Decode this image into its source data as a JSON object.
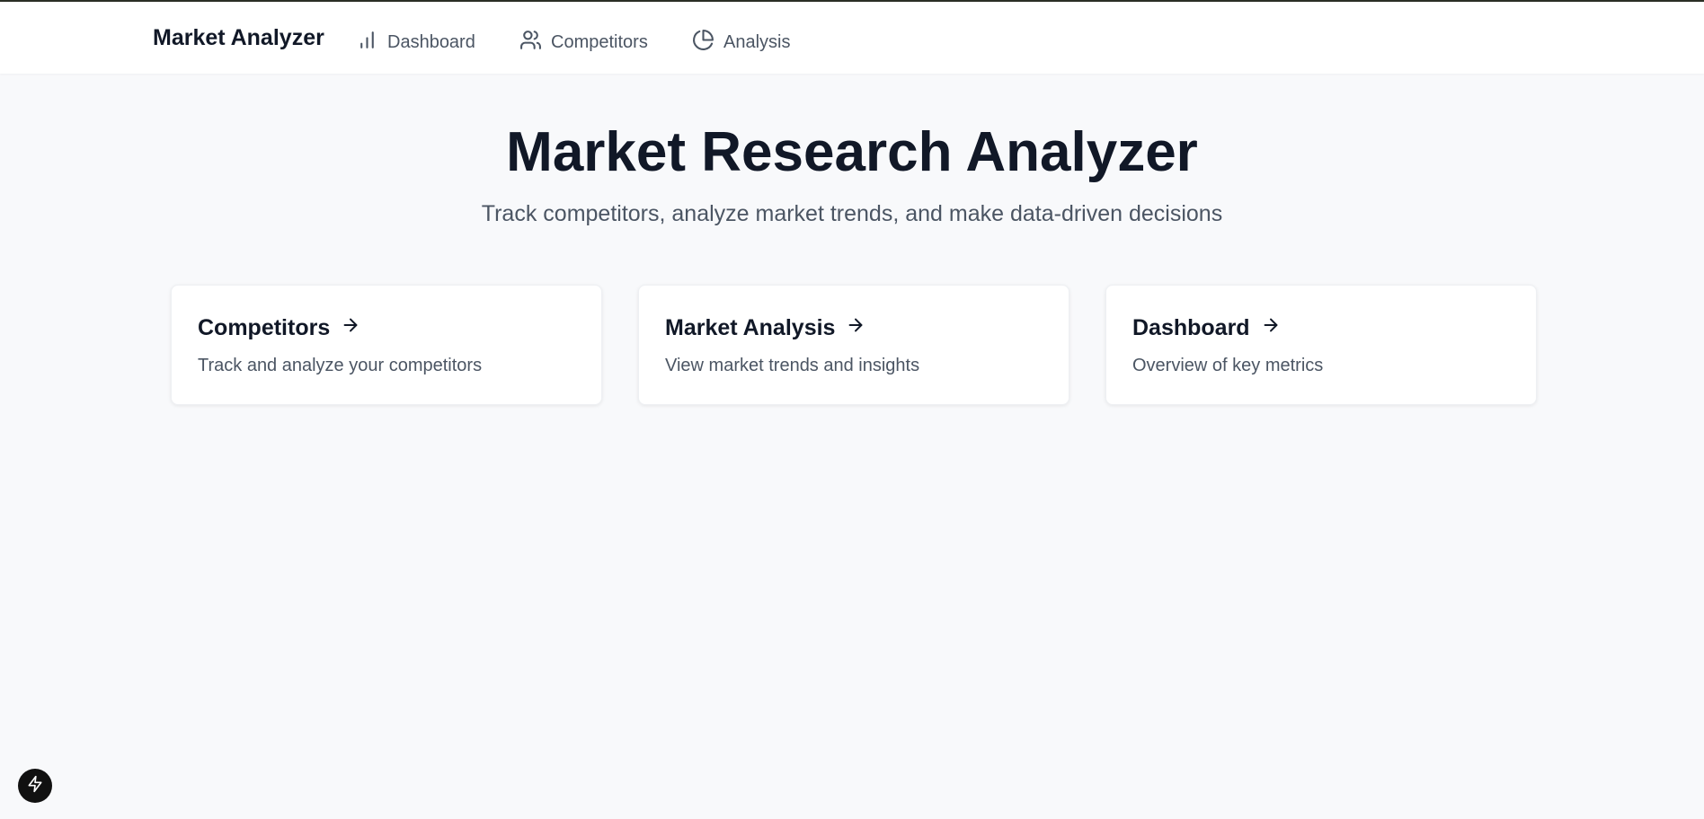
{
  "nav": {
    "brand": "Market Analyzer",
    "links": [
      {
        "label": "Dashboard",
        "icon": "bar-chart-icon"
      },
      {
        "label": "Competitors",
        "icon": "users-icon"
      },
      {
        "label": "Analysis",
        "icon": "pie-chart-icon"
      }
    ]
  },
  "hero": {
    "title": "Market Research Analyzer",
    "subtitle": "Track competitors, analyze market trends, and make data-driven decisions"
  },
  "cards": [
    {
      "title": "Competitors",
      "description": "Track and analyze your competitors",
      "icon": "arrow-right-icon"
    },
    {
      "title": "Market Analysis",
      "description": "View market trends and insights",
      "icon": "arrow-right-icon"
    },
    {
      "title": "Dashboard",
      "description": "Overview of key metrics",
      "icon": "arrow-right-icon"
    }
  ],
  "fab": {
    "icon": "lightning-icon"
  },
  "colors": {
    "background": "#f8f9fb",
    "surface": "#ffffff",
    "text_primary": "#111827",
    "text_secondary": "#4b5563",
    "fab": "#111111"
  }
}
